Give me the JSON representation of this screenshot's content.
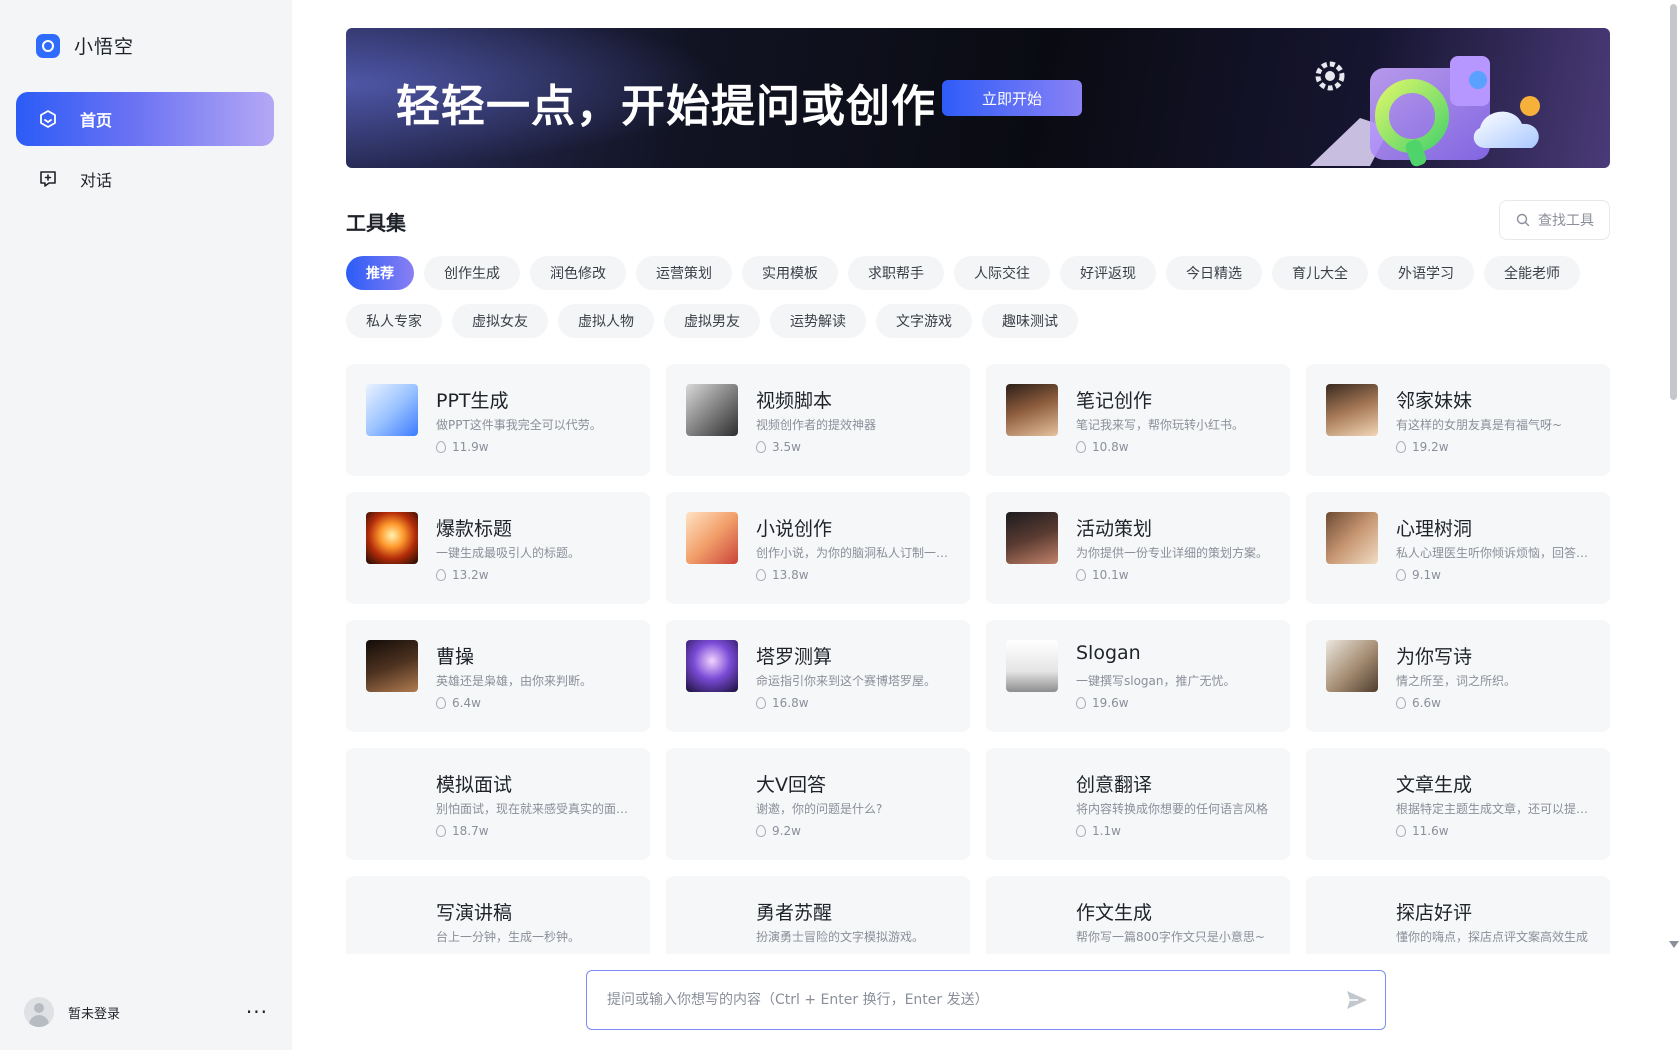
{
  "sidebar": {
    "brand_name": "小悟空",
    "nav": [
      {
        "label": "首页",
        "icon": "hexagon-home-icon",
        "active": true
      },
      {
        "label": "对话",
        "icon": "chat-plus-icon",
        "active": false
      }
    ],
    "user": {
      "name": "暂未登录",
      "more": "···"
    }
  },
  "banner": {
    "title": "轻轻一点，开始提问或创作",
    "button": "立即开始"
  },
  "tools": {
    "title": "工具集",
    "search_placeholder": "查找工具",
    "categories_row1": [
      "推荐",
      "创作生成",
      "润色修改",
      "运营策划",
      "实用模板",
      "求职帮手",
      "人际交往",
      "好评返现",
      "今日精选",
      "育儿大全",
      "外语学习",
      "全能老师"
    ],
    "categories_row2": [
      "私人专家",
      "虚拟女友",
      "虚拟人物",
      "虚拟男友",
      "运势解读",
      "文字游戏",
      "趣味测试"
    ],
    "active_category": "推荐",
    "cards": [
      {
        "title": "PPT生成",
        "desc": "做PPT这件事我完全可以代劳。",
        "count": "11.9w",
        "thumb": "ppt"
      },
      {
        "title": "视频脚本",
        "desc": "视频创作者的提效神器",
        "count": "3.5w",
        "thumb": "video"
      },
      {
        "title": "笔记创作",
        "desc": "笔记我来写，帮你玩转小红书。",
        "count": "10.8w",
        "thumb": "note"
      },
      {
        "title": "邻家妹妹",
        "desc": "有这样的女朋友真是有福气呀~",
        "count": "19.2w",
        "thumb": "girl"
      },
      {
        "title": "爆款标题",
        "desc": "一键生成最吸引人的标题。",
        "count": "13.2w",
        "thumb": "fire"
      },
      {
        "title": "小说创作",
        "desc": "创作小说，为你的脑洞私人订制一本小说",
        "count": "13.8w",
        "thumb": "pen"
      },
      {
        "title": "活动策划",
        "desc": "为你提供一份专业详细的策划方案。",
        "count": "10.1w",
        "thumb": "event"
      },
      {
        "title": "心理树洞",
        "desc": "私人心理医生听你倾诉烦恼，回答你的问题",
        "count": "9.1w",
        "thumb": "hands"
      },
      {
        "title": "曹操",
        "desc": "英雄还是枭雄，由你来判断。",
        "count": "6.4w",
        "thumb": "caocao"
      },
      {
        "title": "塔罗测算",
        "desc": "命运指引你来到这个赛博塔罗屋。",
        "count": "16.8w",
        "thumb": "tarot"
      },
      {
        "title": "Slogan",
        "desc": "一键撰写slogan，推广无忧。",
        "count": "19.6w",
        "thumb": "slogan"
      },
      {
        "title": "为你写诗",
        "desc": "情之所至，词之所织。",
        "count": "6.6w",
        "thumb": "poem"
      },
      {
        "title": "模拟面试",
        "desc": "别怕面试，现在就来感受真实的面试场景",
        "count": "18.7w",
        "thumb": ""
      },
      {
        "title": "大V回答",
        "desc": "谢邀，你的问题是什么?",
        "count": "9.2w",
        "thumb": ""
      },
      {
        "title": "创意翻译",
        "desc": "将内容转换成你想要的任何语言风格",
        "count": "1.1w",
        "thumb": ""
      },
      {
        "title": "文章生成",
        "desc": "根据特定主题生成文章，还可以提供大纲",
        "count": "11.6w",
        "thumb": ""
      },
      {
        "title": "写演讲稿",
        "desc": "台上一分钟，生成一秒钟。",
        "count": "",
        "thumb": ""
      },
      {
        "title": "勇者苏醒",
        "desc": "扮演勇士冒险的文字模拟游戏。",
        "count": "",
        "thumb": ""
      },
      {
        "title": "作文生成",
        "desc": "帮你写一篇800字作文只是小意思~",
        "count": "",
        "thumb": ""
      },
      {
        "title": "探店好评",
        "desc": "懂你的嗨点，探店点评文案高效生成",
        "count": "",
        "thumb": ""
      }
    ]
  },
  "prompt": {
    "placeholder": "提问或输入你想写的内容（Ctrl + Enter 换行，Enter 发送）"
  },
  "colors": {
    "accent": "#2b5cf6",
    "accent_light": "#8a7ff4",
    "sidebar_bg": "#f4f5f7",
    "card_bg": "#f6f7f9"
  }
}
